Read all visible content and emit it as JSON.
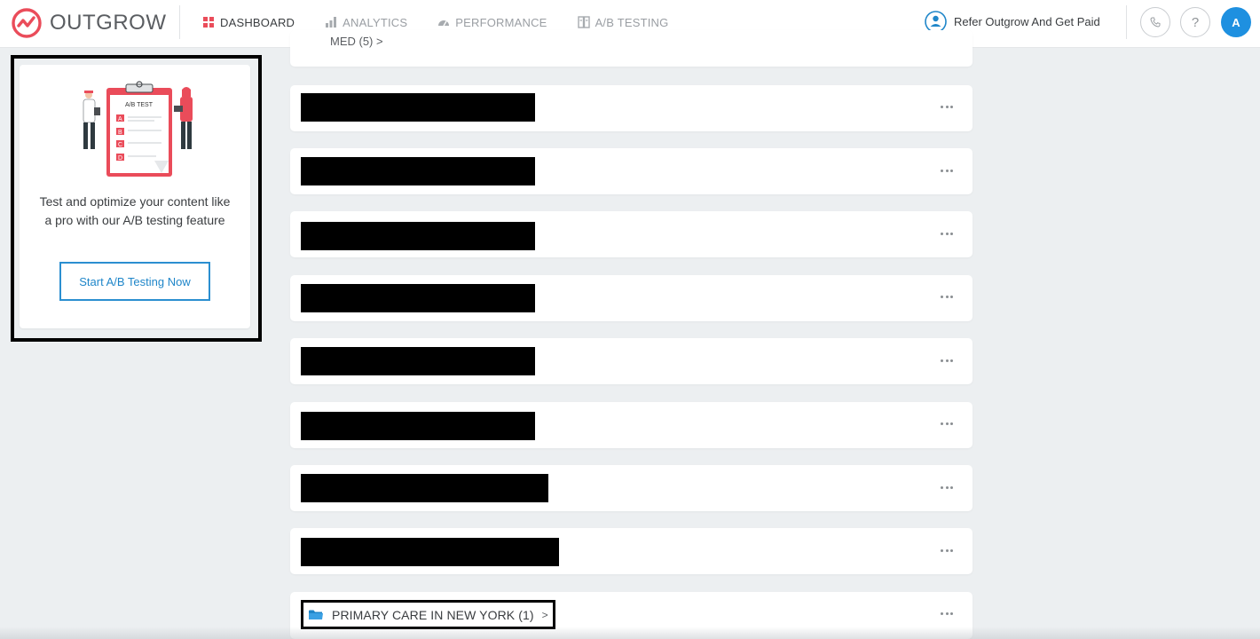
{
  "brand": {
    "name": "OUTGROW",
    "accent": "#ea4c5a",
    "link_color": "#1f86c9"
  },
  "nav": {
    "items": [
      {
        "label": "DASHBOARD",
        "icon": "dashboard-icon",
        "active": true
      },
      {
        "label": "ANALYTICS",
        "icon": "analytics-icon",
        "active": false
      },
      {
        "label": "PERFORMANCE",
        "icon": "performance-icon",
        "active": false
      },
      {
        "label": "A/B TESTING",
        "icon": "ab-testing-icon",
        "active": false
      }
    ]
  },
  "header": {
    "refer_label": "Refer Outgrow And Get Paid",
    "phone_icon": "phone-icon",
    "help_label": "?",
    "avatar_initial": "A"
  },
  "promo": {
    "illustration_title": "A/B TEST",
    "illustration_options": [
      "A",
      "B",
      "C",
      "D"
    ],
    "text": "Test and optimize your content like a pro with our A/B testing feature",
    "button_label": "Start A/B Testing Now"
  },
  "list": {
    "partial_item_label": "MED (5) >",
    "rows": [
      {
        "redacted": true
      },
      {
        "redacted": true
      },
      {
        "redacted": true
      },
      {
        "redacted": true
      },
      {
        "redacted": true
      },
      {
        "redacted": true
      },
      {
        "redacted": true
      },
      {
        "redacted": true
      }
    ],
    "folder": {
      "label": "PRIMARY CARE IN NEW YORK (1)",
      "chevron": ">"
    },
    "more_icon": "more-horizontal-icon"
  }
}
